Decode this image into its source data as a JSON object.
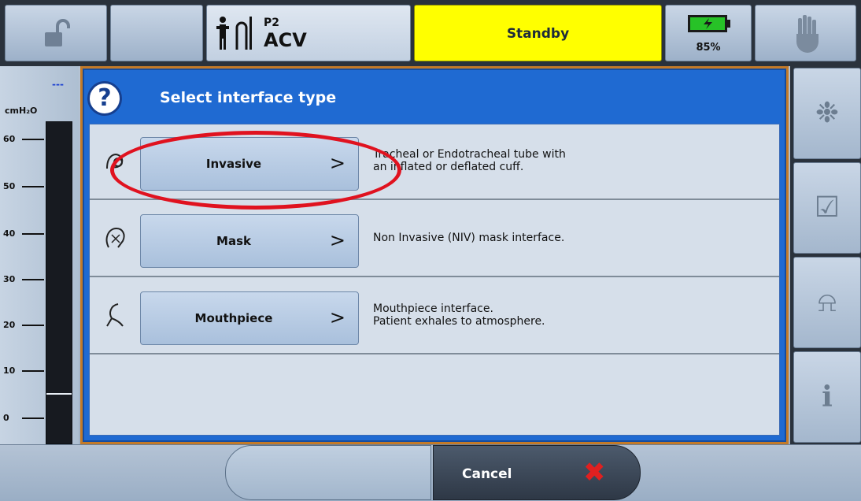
{
  "topbar": {
    "mode_prefix": "P2",
    "mode": "ACV",
    "status": "Standby",
    "battery_percent": "85%"
  },
  "gauge": {
    "dash": "---",
    "unit": "cmH₂O",
    "ticks": [
      "60",
      "50",
      "40",
      "30",
      "20",
      "10",
      "0"
    ]
  },
  "dialog": {
    "help_glyph": "?",
    "title": "Select interface type",
    "options": [
      {
        "label": "Invasive",
        "chevron": ">",
        "desc_line1": "Tracheal or Endotracheal tube with",
        "desc_line2": "an inflated or deflated cuff.",
        "icon": "tube-icon",
        "highlighted": true
      },
      {
        "label": "Mask",
        "chevron": ">",
        "desc_line1": "Non Invasive (NIV) mask interface.",
        "desc_line2": "",
        "icon": "mask-icon"
      },
      {
        "label": "Mouthpiece",
        "chevron": ">",
        "desc_line1": "Mouthpiece interface.",
        "desc_line2": "Patient exhales to atmosphere.",
        "icon": "mouthpiece-icon"
      }
    ]
  },
  "bottombar": {
    "cancel_label": "Cancel",
    "cancel_icon": "✖"
  },
  "sidebar": {
    "items": [
      {
        "icon": "lungs-icon",
        "glyph": "❉"
      },
      {
        "icon": "checklist-icon",
        "glyph": "☑"
      },
      {
        "icon": "bell-icon",
        "glyph": "⍾"
      },
      {
        "icon": "info-icon",
        "glyph": "i"
      }
    ]
  },
  "colors": {
    "status_bg": "#ffff00",
    "dialog_bg": "#1f6ad2",
    "highlight": "#e0121f"
  }
}
